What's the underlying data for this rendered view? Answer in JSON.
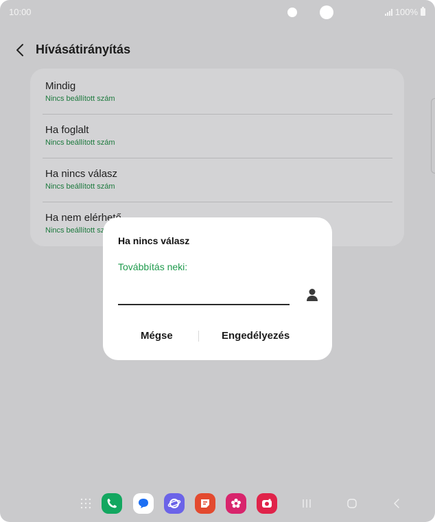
{
  "status_bar": {
    "time": "10:00",
    "battery": "100%",
    "icons": [
      "signal-icon",
      "battery-icon"
    ]
  },
  "header": {
    "title": "Hívásátirányítás",
    "back_icon": "chevron-left-icon"
  },
  "settings": {
    "items": [
      {
        "label": "Mindig",
        "status": "Nincs beállított szám"
      },
      {
        "label": "Ha foglalt",
        "status": "Nincs beállított szám"
      },
      {
        "label": "Ha nincs válasz",
        "status": "Nincs beállított szám"
      },
      {
        "label": "Ha nem elérhető",
        "status": "Nincs beállított szám"
      }
    ]
  },
  "dialog": {
    "title": "Ha nincs válasz",
    "field_label": "Továbbítás neki:",
    "field_value": "",
    "contact_icon": "person-icon",
    "cancel_label": "Mégse",
    "confirm_label": "Engedélyezés"
  },
  "dock": {
    "apps": [
      "apps-grid-icon",
      "phone-icon",
      "messages-icon",
      "internet-icon",
      "notes-icon",
      "gallery-icon",
      "camera-icon"
    ],
    "nav": [
      "recents-icon",
      "home-icon",
      "back-icon"
    ]
  },
  "colors": {
    "accent_green": "#1e9a4c",
    "status_green": "#1d7a3e",
    "overlay_background": "#cacacc",
    "dialog_background": "#ffffff"
  }
}
